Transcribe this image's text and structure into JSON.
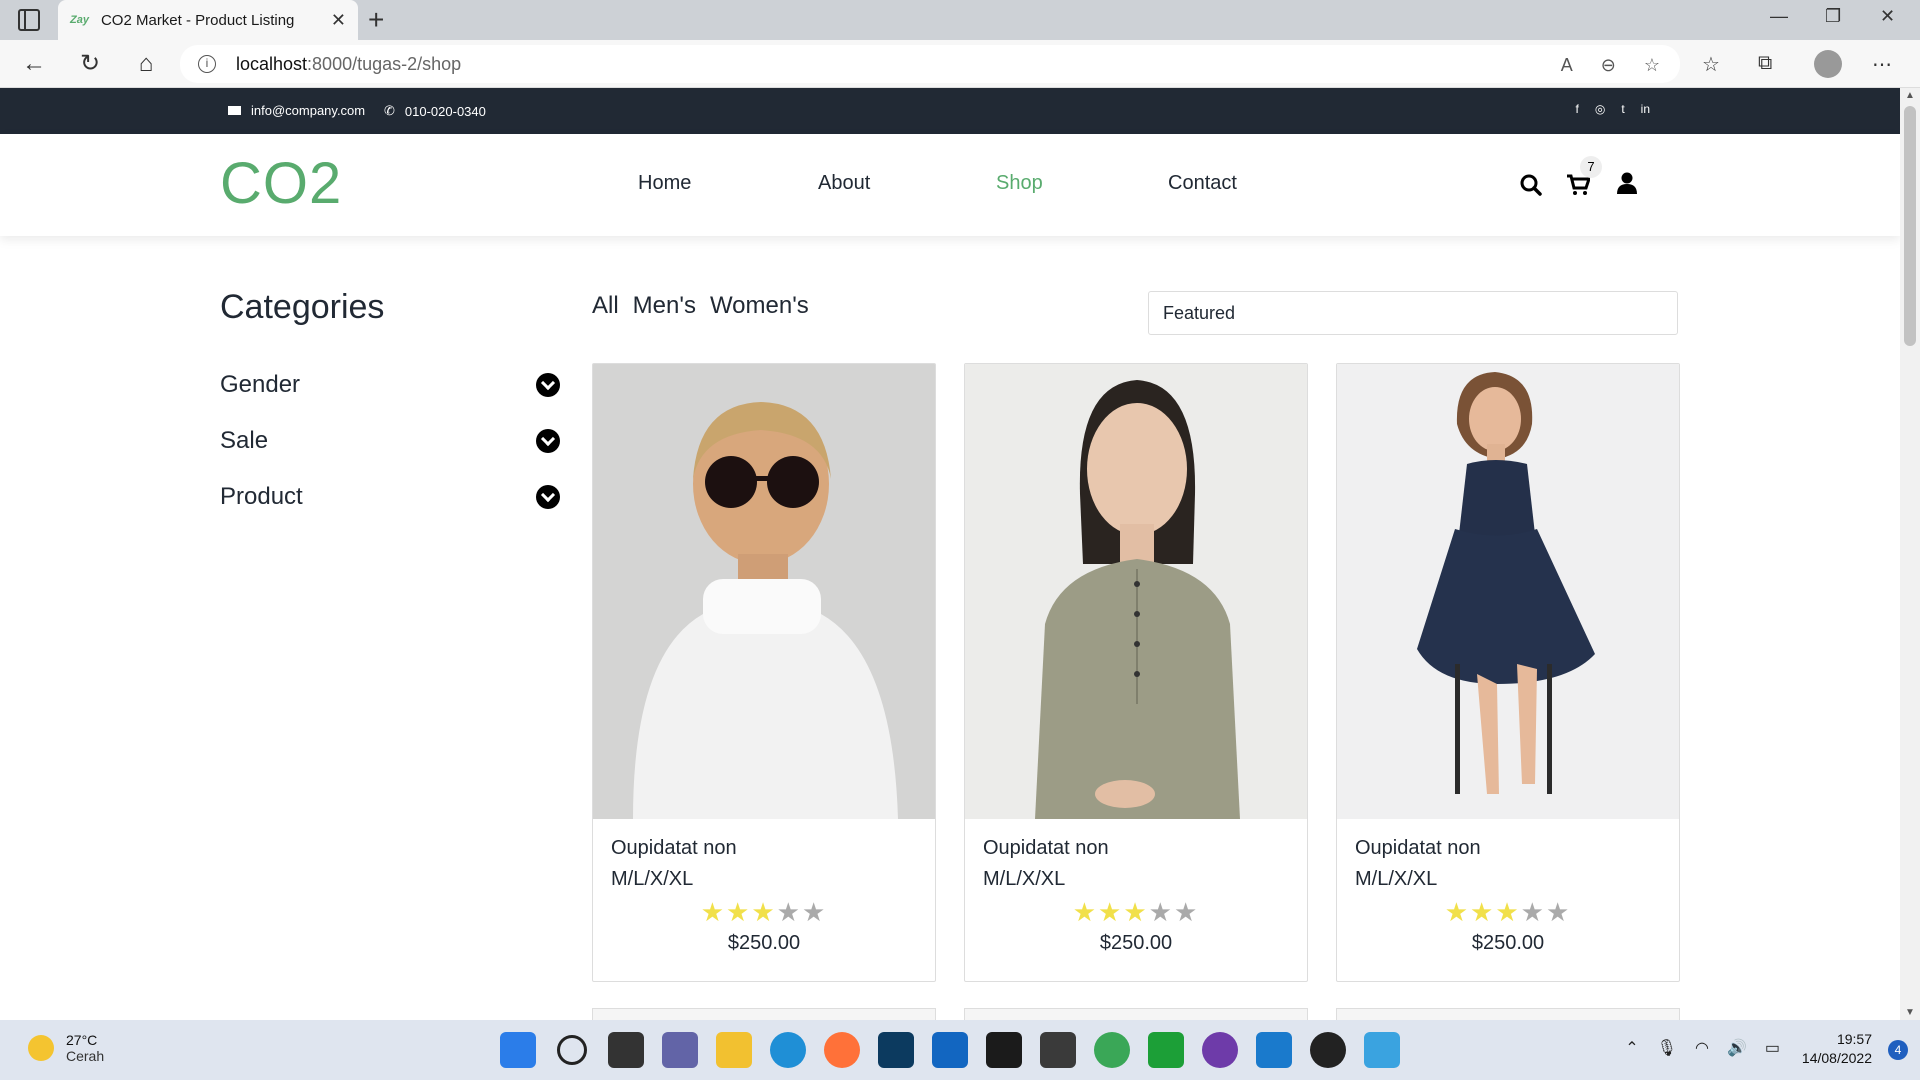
{
  "browser": {
    "tab_favicon": "Zay",
    "tab_title": "CO2 Market - Product Listing",
    "url_host": "localhost",
    "url_path": ":8000/tugas-2/shop"
  },
  "topbar": {
    "email": "info@company.com",
    "phone": "010-020-0340",
    "socials": [
      "facebook-icon",
      "instagram-icon",
      "twitter-icon",
      "linkedin-icon"
    ]
  },
  "nav": {
    "logo": "CO2",
    "menu": [
      "Home",
      "About",
      "Shop",
      "Contact"
    ],
    "active": "Shop",
    "cart_count": "7"
  },
  "sidebar": {
    "title": "Categories",
    "items": [
      "Gender",
      "Sale",
      "Product"
    ]
  },
  "filters": {
    "tabs": [
      "All",
      "Men's",
      "Women's"
    ],
    "sort_selected": "Featured"
  },
  "products": [
    {
      "name": "Oupidatat non",
      "sizes": "M/L/X/XL",
      "rating": 3,
      "max_rating": 5,
      "price": "$250.00"
    },
    {
      "name": "Oupidatat non",
      "sizes": "M/L/X/XL",
      "rating": 3,
      "max_rating": 5,
      "price": "$250.00"
    },
    {
      "name": "Oupidatat non",
      "sizes": "M/L/X/XL",
      "rating": 3,
      "max_rating": 5,
      "price": "$250.00"
    }
  ],
  "taskbar": {
    "temperature": "27°C",
    "weather": "Cerah",
    "time": "19:57",
    "date": "14/08/2022",
    "notifications": "4"
  },
  "colors": {
    "brand_green": "#59ab6e",
    "topbar_dark": "#212934",
    "star_active": "#f1e04a",
    "star_inactive": "#aaaaaa"
  }
}
